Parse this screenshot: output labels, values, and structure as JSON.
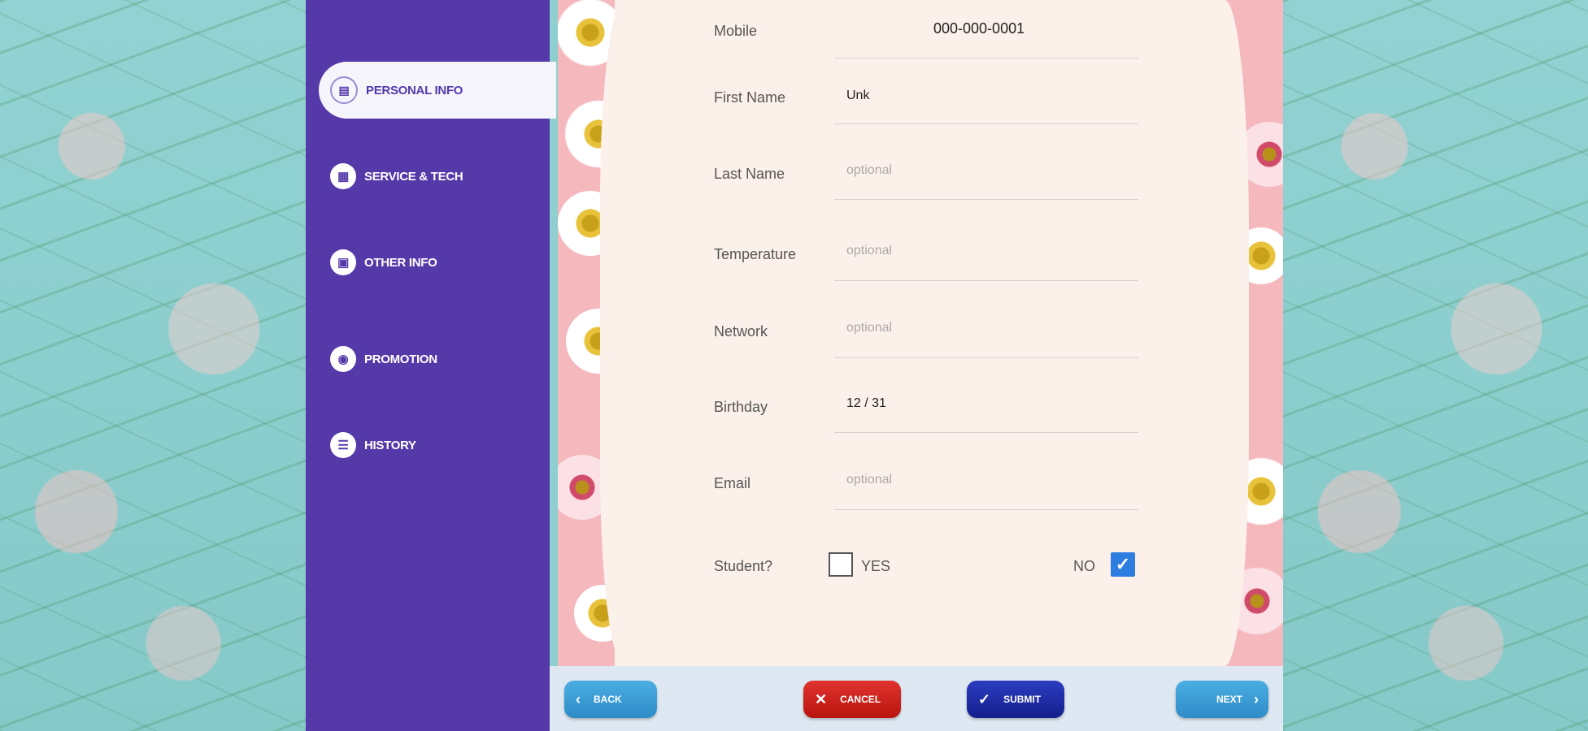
{
  "sidebar": {
    "items": [
      {
        "label": "PERSONAL INFO",
        "icon": "id-card-icon",
        "active": true
      },
      {
        "label": "SERVICE & TECH",
        "icon": "services-icon"
      },
      {
        "label": "OTHER INFO",
        "icon": "info-icon"
      },
      {
        "label": "PROMOTION",
        "icon": "promotion-icon"
      },
      {
        "label": "HISTORY",
        "icon": "history-list-icon"
      }
    ]
  },
  "form": {
    "mobile": {
      "label": "Mobile",
      "value": "000-000-0001"
    },
    "first_name": {
      "label": "First Name",
      "value": "Unk"
    },
    "last_name": {
      "label": "Last Name",
      "placeholder": "optional"
    },
    "temperature": {
      "label": "Temperature",
      "placeholder": "optional"
    },
    "network": {
      "label": "Network",
      "placeholder": "optional"
    },
    "birthday": {
      "label": "Birthday",
      "value": "12 / 31"
    },
    "email": {
      "label": "Email",
      "placeholder": "optional"
    },
    "student": {
      "label": "Student?",
      "yes_label": "YES",
      "no_label": "NO",
      "yes_checked": false,
      "no_checked": true
    }
  },
  "buttons": {
    "back": "BACK",
    "cancel": "CANCEL",
    "submit": "SUBMIT",
    "next": "NEXT"
  },
  "colors": {
    "sidebar": "#5539a9",
    "back_next": "#3f9fd6",
    "cancel": "#d4211f",
    "submit": "#1f2fa8",
    "checkbox": "#2e7de0"
  }
}
